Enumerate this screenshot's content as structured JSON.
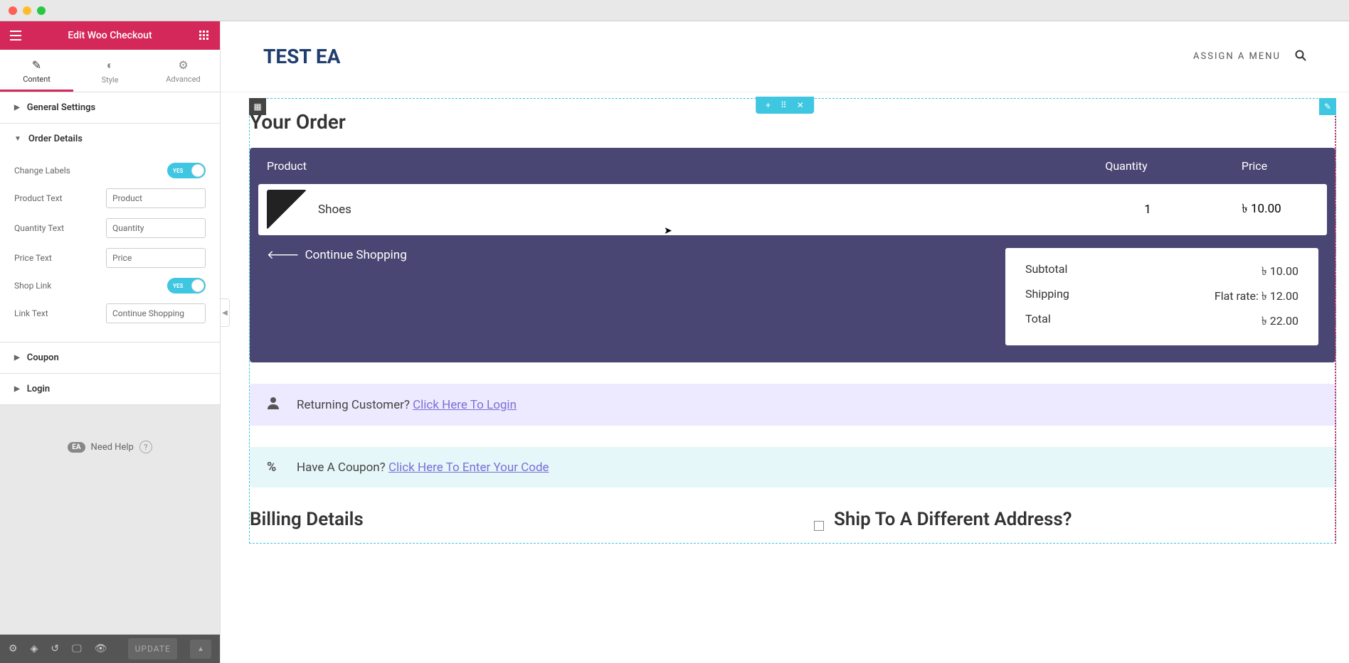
{
  "editor": {
    "title": "Edit Woo Checkout",
    "tabs": {
      "content": "Content",
      "style": "Style",
      "advanced": "Advanced"
    },
    "sections": {
      "general": "General Settings",
      "order_details": "Order Details",
      "coupon": "Coupon",
      "login": "Login"
    },
    "fields": {
      "change_labels": "Change Labels",
      "product_text": {
        "label": "Product Text",
        "value": "Product"
      },
      "quantity_text": {
        "label": "Quantity Text",
        "value": "Quantity"
      },
      "price_text": {
        "label": "Price Text",
        "value": "Price"
      },
      "shop_link": "Shop Link",
      "link_text": {
        "label": "Link Text",
        "value": "Continue Shopping"
      },
      "toggle_yes": "YES"
    },
    "help": "Need Help",
    "ea_badge": "EA",
    "update": "UPDATE"
  },
  "site": {
    "title": "TEST EA",
    "menu": "ASSIGN A MENU"
  },
  "checkout": {
    "heading": "Your Order",
    "columns": {
      "product": "Product",
      "quantity": "Quantity",
      "price": "Price"
    },
    "items": [
      {
        "name": "Shoes",
        "qty": "1",
        "price": "৳ 10.00"
      }
    ],
    "continue": "Continue Shopping",
    "totals": {
      "subtotal_label": "Subtotal",
      "subtotal": "৳ 10.00",
      "shipping_label": "Shipping",
      "shipping": "Flat rate: ৳ 12.00",
      "total_label": "Total",
      "total": "৳ 22.00"
    },
    "login_notice": {
      "text": "Returning Customer? ",
      "link": "Click Here To Login"
    },
    "coupon_notice": {
      "text": "Have A Coupon? ",
      "link": "Click Here To Enter Your Code"
    },
    "billing": "Billing Details",
    "ship_diff": "Ship To A Different Address?"
  }
}
